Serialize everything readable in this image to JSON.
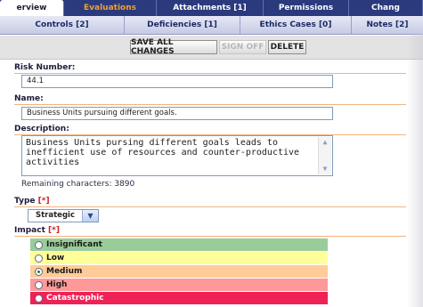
{
  "tabs_top": [
    {
      "label": "erview"
    },
    {
      "label": "Evaluations"
    },
    {
      "label": "Attachments [1]"
    },
    {
      "label": "Permissions"
    },
    {
      "label": "Chang"
    }
  ],
  "tabs_second": [
    {
      "label": "Controls [2]"
    },
    {
      "label": "Deficiencies [1]"
    },
    {
      "label": "Ethics Cases [0]"
    },
    {
      "label": "Notes [2]"
    }
  ],
  "toolbar": {
    "save_label": "SAVE ALL CHANGES",
    "signoff_label": "SIGN OFF",
    "delete_label": "DELETE"
  },
  "form": {
    "risk_number_label": "Risk Number:",
    "risk_number_value": "44.1",
    "name_label": "Name:",
    "name_value": "Business Units pursuing different goals.",
    "description_label": "Description:",
    "description_value": "Business Units pursing different goals leads to inefficient use of resources and counter-productive activities",
    "remaining_label": "Remaining characters:",
    "remaining_value": "3890",
    "type_label": "Type",
    "required_marker": "[*]",
    "type_value": "Strategic",
    "impact_label": "Impact"
  },
  "impact_options": [
    {
      "label": "Insignificant",
      "color": "#99cc99",
      "selected": false
    },
    {
      "label": "Low",
      "color": "#ffff99",
      "selected": false
    },
    {
      "label": "Medium",
      "color": "#ffcc99",
      "selected": true
    },
    {
      "label": "High",
      "color": "#ff9999",
      "selected": false
    },
    {
      "label": "Catastrophic",
      "color": "#ee2255",
      "selected": false
    }
  ],
  "colors": {
    "tab_bar": "#2a3a7d",
    "active_tab_text": "#f0a030",
    "separator": "#f2b47c",
    "required": "#cc2222"
  }
}
